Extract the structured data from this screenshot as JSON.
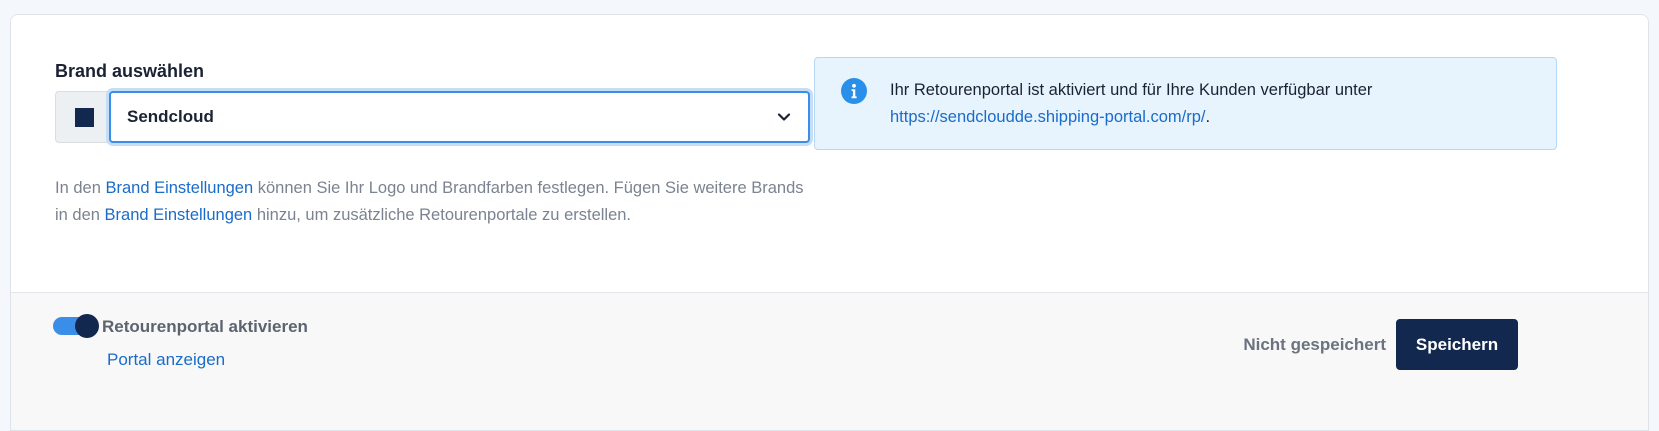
{
  "brand": {
    "label": "Brand auswählen",
    "selected": "Sendcloud",
    "swatch_color": "#13284f"
  },
  "help": {
    "part1": "In den ",
    "link1": "Brand Einstellungen",
    "part2": " können Sie Ihr Logo und Brandfarben festlegen. Fügen Sie weitere Brands in den ",
    "link2": "Brand Einstellungen",
    "part3": " hinzu, um zusätzliche Retourenportale zu erstellen."
  },
  "info": {
    "icon": "info-icon",
    "text": "Ihr Retourenportal ist aktiviert und für Ihre Kunden verfügbar unter",
    "url": "https://sendcloudde.shipping-portal.com/rp/",
    "suffix": "."
  },
  "footer": {
    "toggle_label": "Retourenportal aktivieren",
    "toggle_on": true,
    "portal_link": "Portal anzeigen",
    "status": "Nicht gespeichert",
    "save_label": "Speichern"
  },
  "colors": {
    "accent": "#3b8ee8",
    "primary": "#13284f",
    "link": "#1a6cc9",
    "info_bg": "#e7f3fd"
  }
}
